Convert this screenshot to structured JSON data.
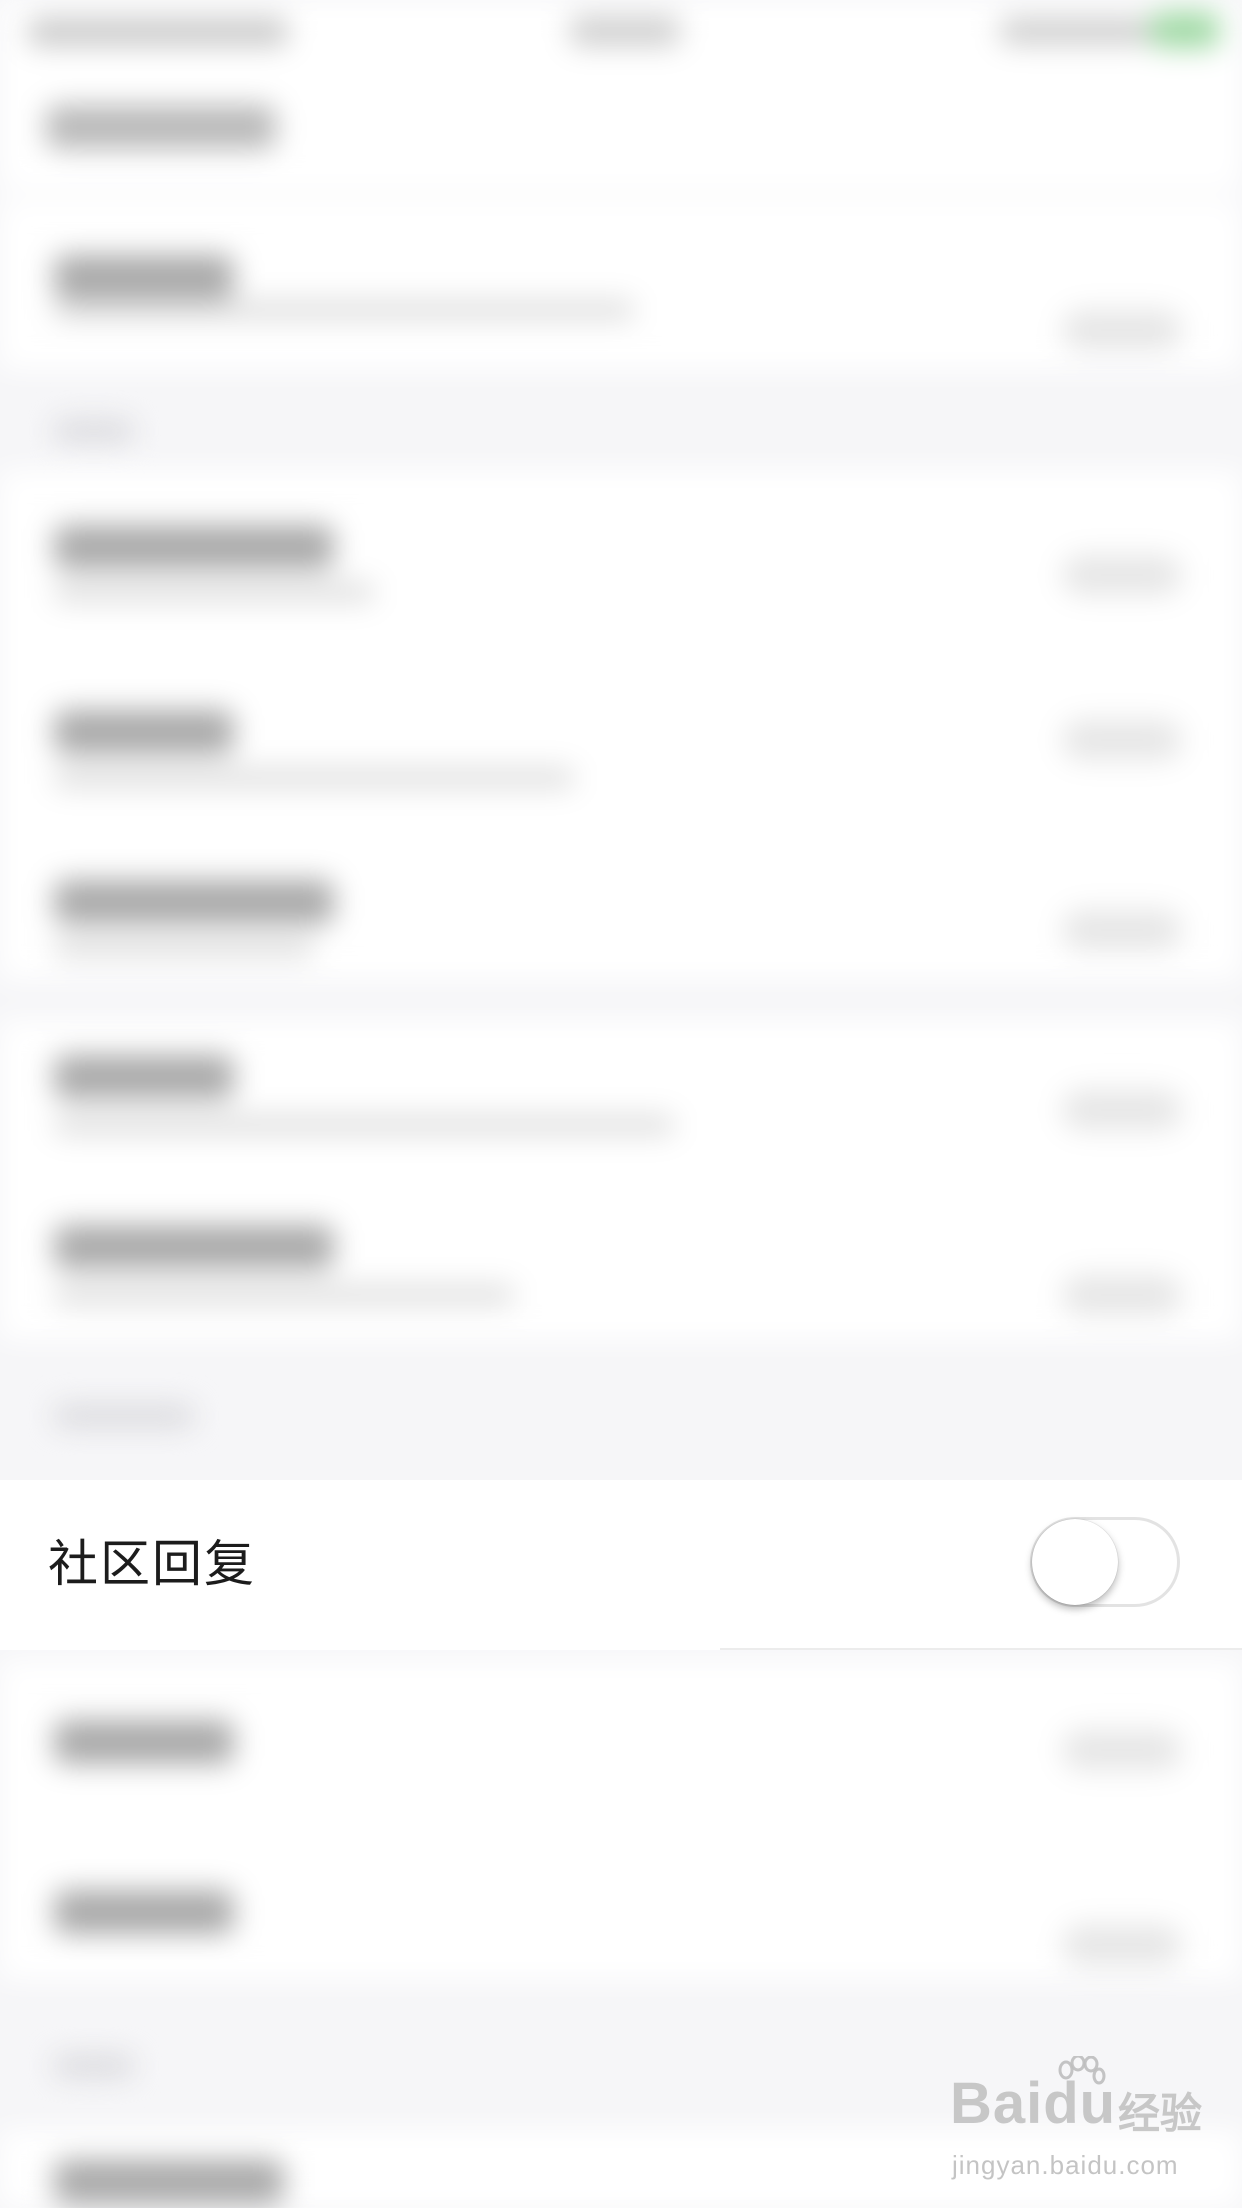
{
  "focused_setting": {
    "label": "社区回复",
    "toggle_on": false
  },
  "watermark": {
    "logo_text": "Baidu",
    "brand_cn": "经验",
    "url": "jingyan.baidu.com"
  },
  "colors": {
    "toggle_off_border": "#e3e3e3",
    "knob": "#ffffff",
    "battery_green": "#4cd964"
  }
}
